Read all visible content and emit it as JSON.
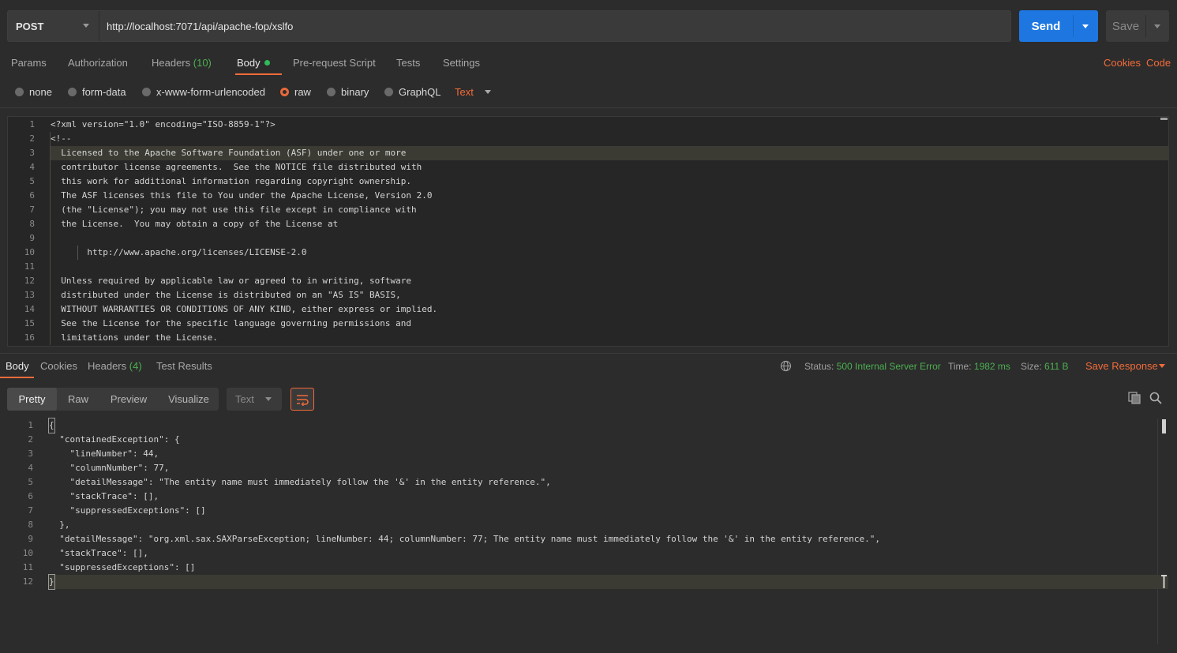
{
  "request": {
    "method": "POST",
    "url": "http://localhost:7071/api/apache-fop/xslfo",
    "send_label": "Send",
    "save_label": "Save",
    "tabs": [
      {
        "label": "Params"
      },
      {
        "label": "Authorization"
      },
      {
        "label": "Headers",
        "count": "(10)"
      },
      {
        "label": "Body"
      },
      {
        "label": "Pre-request Script"
      },
      {
        "label": "Tests"
      },
      {
        "label": "Settings"
      }
    ],
    "links": {
      "cookies": "Cookies",
      "code": "Code"
    },
    "body_types": [
      "none",
      "form-data",
      "x-www-form-urlencoded",
      "raw",
      "binary",
      "GraphQL"
    ],
    "selected_body_type": "raw",
    "text_mode": "Text",
    "body_lines": [
      "<?xml version=\"1.0\" encoding=\"ISO-8859-1\"?>",
      "<!--",
      "  Licensed to the Apache Software Foundation (ASF) under one or more",
      "  contributor license agreements.  See the NOTICE file distributed with",
      "  this work for additional information regarding copyright ownership.",
      "  The ASF licenses this file to You under the Apache License, Version 2.0",
      "  (the \"License\"); you may not use this file except in compliance with",
      "  the License.  You may obtain a copy of the License at",
      "",
      "       http://www.apache.org/licenses/LICENSE-2.0",
      "",
      "  Unless required by applicable law or agreed to in writing, software",
      "  distributed under the License is distributed on an \"AS IS\" BASIS,",
      "  WITHOUT WARRANTIES OR CONDITIONS OF ANY KIND, either express or implied.",
      "  See the License for the specific language governing permissions and",
      "  limitations under the License."
    ]
  },
  "response": {
    "tabs": [
      {
        "label": "Body"
      },
      {
        "label": "Cookies"
      },
      {
        "label": "Headers",
        "count": "(4)"
      },
      {
        "label": "Test Results"
      }
    ],
    "status_label": "Status:",
    "status_value": "500 Internal Server Error",
    "time_label": "Time:",
    "time_value": "1982 ms",
    "size_label": "Size:",
    "size_value": "611 B",
    "save_response_label": "Save Response",
    "view_modes": [
      "Pretty",
      "Raw",
      "Preview",
      "Visualize"
    ],
    "active_view_mode": "Pretty",
    "format": "Text",
    "body_lines": [
      "{",
      "  \"containedException\": {",
      "    \"lineNumber\": 44,",
      "    \"columnNumber\": 77,",
      "    \"detailMessage\": \"The entity name must immediately follow the '&' in the entity reference.\",",
      "    \"stackTrace\": [],",
      "    \"suppressedExceptions\": []",
      "  },",
      "  \"detailMessage\": \"org.xml.sax.SAXParseException; lineNumber: 44; columnNumber: 77; The entity name must immediately follow the '&' in the entity reference.\",",
      "  \"stackTrace\": [],",
      "  \"suppressedExceptions\": []",
      "}"
    ]
  },
  "icons": {
    "globe": "globe-icon",
    "wrap": "wrap-lines-icon",
    "copy": "copy-icon",
    "search": "search-icon"
  },
  "colors": {
    "accent": "#f26b3a",
    "send": "#1e77e1",
    "success": "#4caf50",
    "background": "#2c2c2c"
  }
}
